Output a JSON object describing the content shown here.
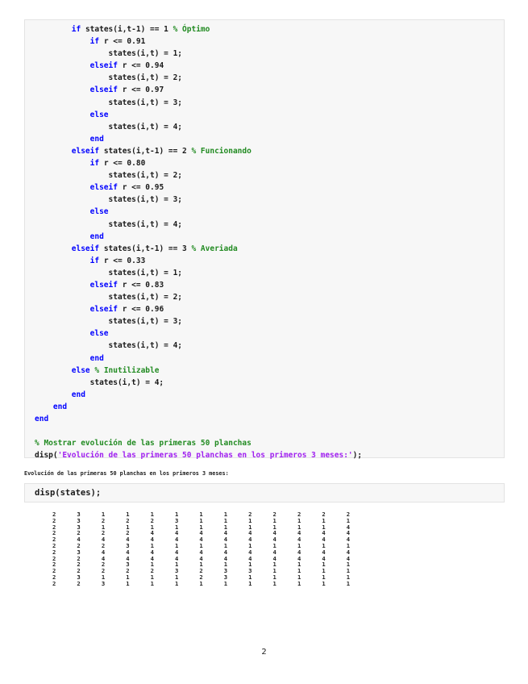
{
  "code_cell_1": {
    "lines": [
      [
        [
          "        ",
          ""
        ],
        [
          "if",
          "kw"
        ],
        [
          " states(i,t-1) == 1 ",
          ""
        ],
        [
          "% Óptimo",
          "cm"
        ]
      ],
      [
        [
          "            ",
          ""
        ],
        [
          "if",
          "kw"
        ],
        [
          " r <= 0.91",
          ""
        ]
      ],
      [
        [
          "                states(i,t) = 1;",
          ""
        ]
      ],
      [
        [
          "            ",
          ""
        ],
        [
          "elseif",
          "kw"
        ],
        [
          " r <= 0.94",
          ""
        ]
      ],
      [
        [
          "                states(i,t) = 2;",
          ""
        ]
      ],
      [
        [
          "            ",
          ""
        ],
        [
          "elseif",
          "kw"
        ],
        [
          " r <= 0.97",
          ""
        ]
      ],
      [
        [
          "                states(i,t) = 3;",
          ""
        ]
      ],
      [
        [
          "            ",
          ""
        ],
        [
          "else",
          "kw"
        ]
      ],
      [
        [
          "                states(i,t) = 4;",
          ""
        ]
      ],
      [
        [
          "            ",
          ""
        ],
        [
          "end",
          "kw"
        ]
      ],
      [
        [
          "        ",
          ""
        ],
        [
          "elseif",
          "kw"
        ],
        [
          " states(i,t-1) == 2 ",
          ""
        ],
        [
          "% Funcionando",
          "cm"
        ]
      ],
      [
        [
          "            ",
          ""
        ],
        [
          "if",
          "kw"
        ],
        [
          " r <= 0.80",
          ""
        ]
      ],
      [
        [
          "                states(i,t) = 2;",
          ""
        ]
      ],
      [
        [
          "            ",
          ""
        ],
        [
          "elseif",
          "kw"
        ],
        [
          " r <= 0.95",
          ""
        ]
      ],
      [
        [
          "                states(i,t) = 3;",
          ""
        ]
      ],
      [
        [
          "            ",
          ""
        ],
        [
          "else",
          "kw"
        ]
      ],
      [
        [
          "                states(i,t) = 4;",
          ""
        ]
      ],
      [
        [
          "            ",
          ""
        ],
        [
          "end",
          "kw"
        ]
      ],
      [
        [
          "        ",
          ""
        ],
        [
          "elseif",
          "kw"
        ],
        [
          " states(i,t-1) == 3 ",
          ""
        ],
        [
          "% Averiada",
          "cm"
        ]
      ],
      [
        [
          "            ",
          ""
        ],
        [
          "if",
          "kw"
        ],
        [
          " r <= 0.33",
          ""
        ]
      ],
      [
        [
          "                states(i,t) = 1;",
          ""
        ]
      ],
      [
        [
          "            ",
          ""
        ],
        [
          "elseif",
          "kw"
        ],
        [
          " r <= 0.83",
          ""
        ]
      ],
      [
        [
          "                states(i,t) = 2;",
          ""
        ]
      ],
      [
        [
          "            ",
          ""
        ],
        [
          "elseif",
          "kw"
        ],
        [
          " r <= 0.96",
          ""
        ]
      ],
      [
        [
          "                states(i,t) = 3;",
          ""
        ]
      ],
      [
        [
          "            ",
          ""
        ],
        [
          "else",
          "kw"
        ]
      ],
      [
        [
          "                states(i,t) = 4;",
          ""
        ]
      ],
      [
        [
          "            ",
          ""
        ],
        [
          "end",
          "kw"
        ]
      ],
      [
        [
          "        ",
          ""
        ],
        [
          "else",
          "kw"
        ],
        [
          " ",
          ""
        ],
        [
          "% Inutilizable",
          "cm"
        ]
      ],
      [
        [
          "            states(i,t) = 4;",
          ""
        ]
      ],
      [
        [
          "        ",
          ""
        ],
        [
          "end",
          "kw"
        ]
      ],
      [
        [
          "    ",
          ""
        ],
        [
          "end",
          "kw"
        ]
      ],
      [
        [
          "end",
          "kw"
        ]
      ],
      [
        [
          "",
          ""
        ]
      ],
      [
        [
          "% Mostrar evolución de las primeras 50 planchas",
          "cm"
        ]
      ],
      [
        [
          "disp(",
          ""
        ],
        [
          "'Evolución de las primeras 50 planchas en los primeros 3 meses:'",
          "str"
        ],
        [
          ");",
          ""
        ]
      ]
    ]
  },
  "output_text": "Evolución de las primeras 50 planchas en los primeros 3 meses:",
  "code_cell_2": {
    "code": "disp(states);"
  },
  "matrix": [
    [
      2,
      3,
      1,
      1,
      1,
      1,
      1,
      1,
      2,
      2,
      2,
      2,
      2
    ],
    [
      2,
      3,
      2,
      2,
      2,
      3,
      1,
      1,
      1,
      1,
      1,
      1,
      1
    ],
    [
      2,
      3,
      1,
      1,
      1,
      1,
      1,
      1,
      1,
      1,
      1,
      1,
      4
    ],
    [
      2,
      2,
      2,
      2,
      4,
      4,
      4,
      4,
      4,
      4,
      4,
      4,
      4
    ],
    [
      2,
      4,
      4,
      4,
      4,
      4,
      4,
      4,
      4,
      4,
      4,
      4,
      4
    ],
    [
      2,
      2,
      2,
      3,
      1,
      1,
      1,
      1,
      1,
      1,
      1,
      1,
      1
    ],
    [
      2,
      3,
      4,
      4,
      4,
      4,
      4,
      4,
      4,
      4,
      4,
      4,
      4
    ],
    [
      2,
      2,
      4,
      4,
      4,
      4,
      4,
      4,
      4,
      4,
      4,
      4,
      4
    ],
    [
      2,
      2,
      2,
      3,
      1,
      1,
      1,
      1,
      1,
      1,
      1,
      1,
      1
    ],
    [
      2,
      2,
      2,
      2,
      2,
      3,
      2,
      3,
      3,
      1,
      1,
      1,
      1
    ],
    [
      2,
      3,
      1,
      1,
      1,
      1,
      2,
      3,
      1,
      1,
      1,
      1,
      1
    ],
    [
      2,
      2,
      3,
      1,
      1,
      1,
      1,
      1,
      1,
      1,
      1,
      1,
      1
    ]
  ],
  "page_number": "2",
  "colors": {
    "keyword": "#0000ff",
    "comment": "#228b22",
    "string": "#a020f0",
    "cell_bg": "#f7f7f7"
  }
}
